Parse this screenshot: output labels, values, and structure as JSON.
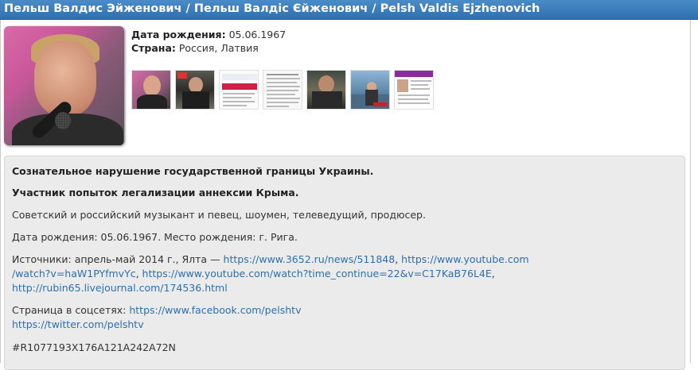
{
  "title": "Пельш Валдис Эйженович / Пельш Валдіс Єйженович / Pelsh Valdis Ejzhenovich",
  "info": {
    "birth_label": "Дата рождения:",
    "birth_value": "05.06.1967",
    "country_label": "Страна:",
    "country_value": "Россия, Латвия"
  },
  "thumbnails": [
    "photo-thumb-1",
    "photo-thumb-2",
    "document-thumb-3",
    "document-thumb-4",
    "photo-thumb-5",
    "photo-thumb-6",
    "profile-thumb-7"
  ],
  "description": {
    "headline1": "Сознательное нарушение государственной границы Украины.",
    "headline2": "Участник попыток легализации аннексии Крыма.",
    "bio": "Советский и российский музыкант и певец, шоумен, телеведущий, продюсер.",
    "birth": "Дата рождения: 05.06.1967. Место рождения: г. Рига.",
    "sources_prefix": "Источники: апрель-май 2014 г., Ялта — ",
    "source_link_1": "https://www.3652.ru/news/511848",
    "source_link_2a": "https://www.youtube.com",
    "source_link_2b": "/watch?v=haW1PYfmvYc",
    "source_link_3": "https://www.youtube.com/watch?time_continue=22&v=C17KaB76L4E",
    "source_link_4": "http://rubin65.livejournal.com/174536.html",
    "social_prefix": "Страница в соцсетях: ",
    "social_link_1": "https://www.facebook.com/pelshtv",
    "social_link_2": "https://twitter.com/pelshtv",
    "code": "#R1077193X176A121A242A72N"
  }
}
